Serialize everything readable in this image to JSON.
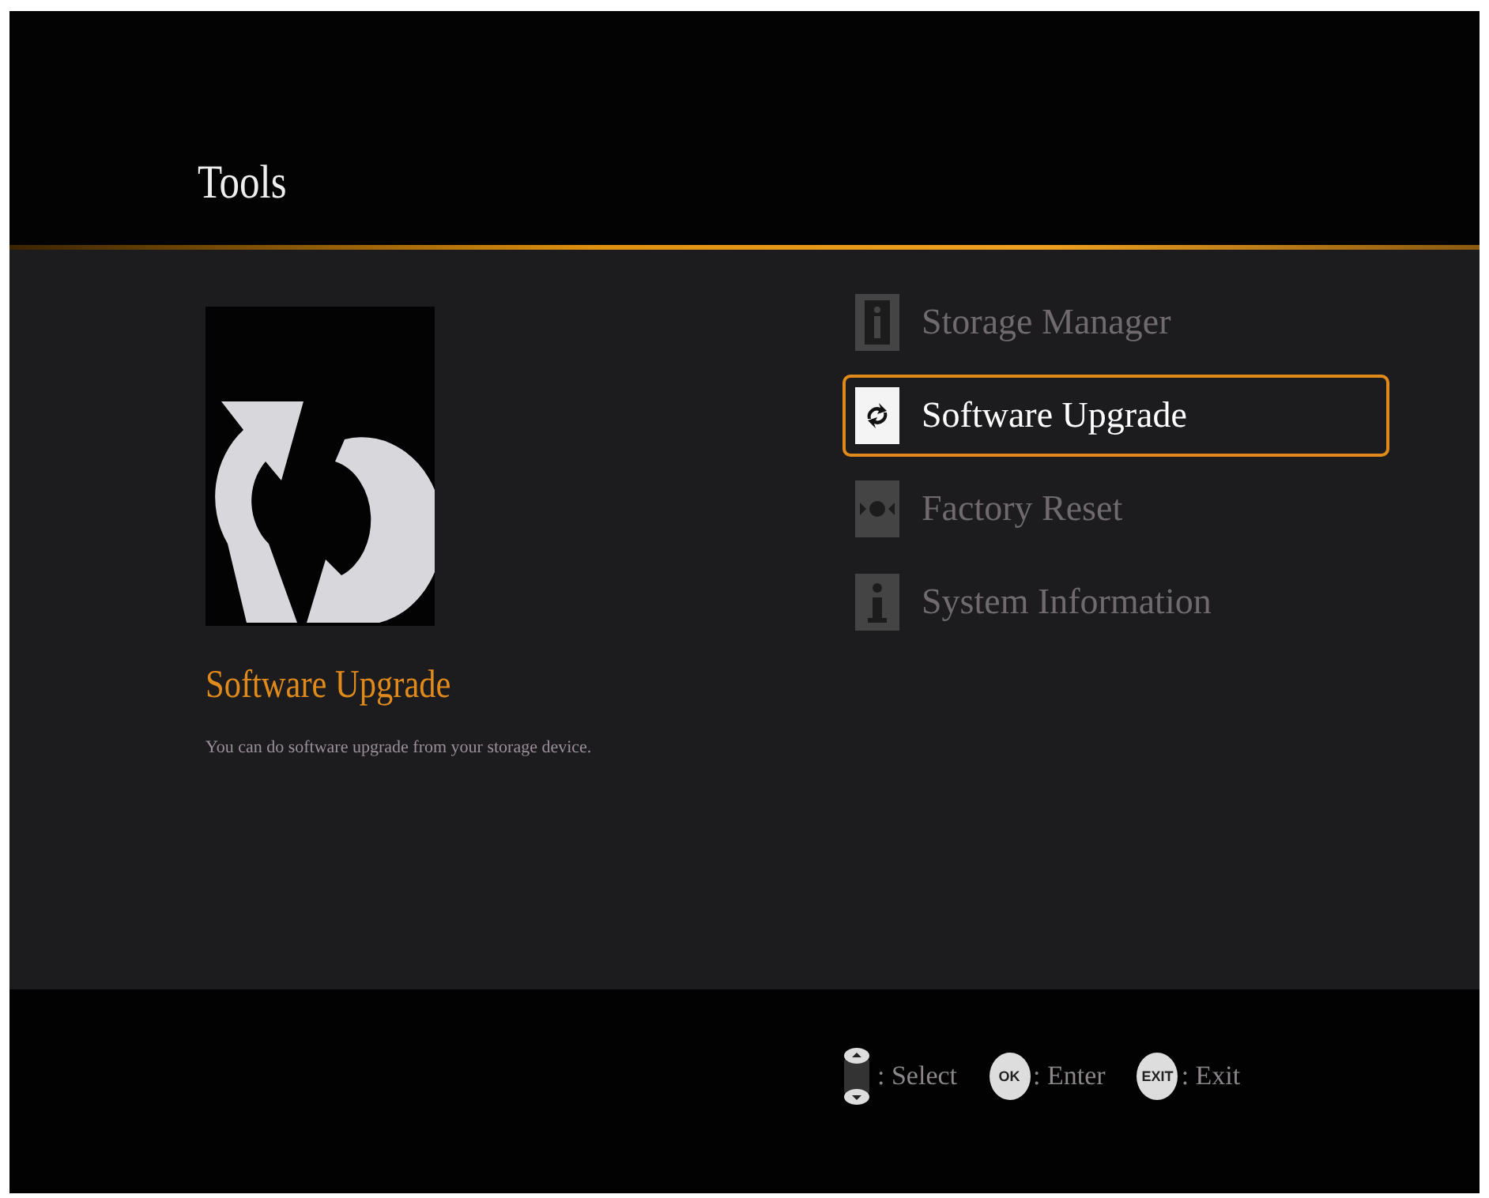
{
  "header": {
    "title": "Tools"
  },
  "preview": {
    "title": "Software Upgrade",
    "description": "You can do software upgrade from your storage device."
  },
  "menu": [
    {
      "label": "Storage Manager",
      "kind": "storage",
      "selected": false
    },
    {
      "label": "Software Upgrade",
      "kind": "upgrade",
      "selected": true
    },
    {
      "label": "Factory Reset",
      "kind": "reset",
      "selected": false
    },
    {
      "label": "System Information",
      "kind": "info",
      "selected": false
    }
  ],
  "hints": [
    {
      "kind": "arrows",
      "label": ": Select"
    },
    {
      "kind": "key",
      "key": "OK",
      "label": ": Enter"
    },
    {
      "kind": "key",
      "key": "EXIT",
      "label": ": Exit"
    }
  ]
}
